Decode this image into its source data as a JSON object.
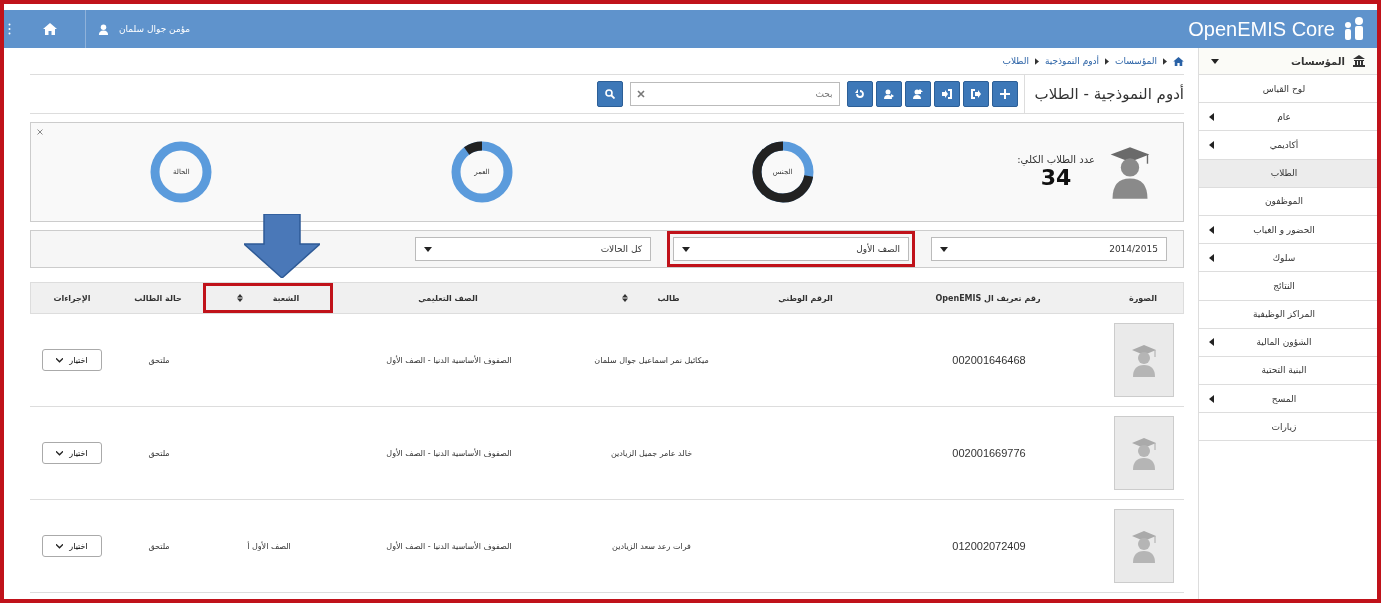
{
  "header": {
    "logo": "OpenEMIS Core",
    "user": "مؤمن جوال سلمان"
  },
  "sidebar": {
    "title": "المؤسسات",
    "items": [
      {
        "label": "لوح القياس",
        "expandable": false,
        "selected": false
      },
      {
        "label": "عام",
        "expandable": true,
        "selected": false
      },
      {
        "label": "أكاديمي",
        "expandable": true,
        "selected": false
      },
      {
        "label": "الطلاب",
        "expandable": false,
        "selected": true
      },
      {
        "label": "الموظفون",
        "expandable": false,
        "selected": false
      },
      {
        "label": "الحضور و الغياب",
        "expandable": true,
        "selected": false
      },
      {
        "label": "سلوك",
        "expandable": true,
        "selected": false
      },
      {
        "label": "النتائج",
        "expandable": false,
        "selected": false
      },
      {
        "label": "المراكز الوظيفية",
        "expandable": false,
        "selected": false
      },
      {
        "label": "الشؤون المالية",
        "expandable": true,
        "selected": false
      },
      {
        "label": "البنية التحتية",
        "expandable": false,
        "selected": false
      },
      {
        "label": "المسح",
        "expandable": true,
        "selected": false
      },
      {
        "label": "زيارات",
        "expandable": false,
        "selected": false
      }
    ]
  },
  "breadcrumb": [
    "المؤسسات",
    "أدوم النموذجية",
    "الطلاب"
  ],
  "page_title": "أدوم النموذجية - الطلاب",
  "search": {
    "placeholder": "بحث"
  },
  "stats": {
    "label": "عدد الطلاب الكلي:",
    "total": "34",
    "charts": [
      {
        "label": "الجنس",
        "kind": "gender"
      },
      {
        "label": "العمر",
        "kind": "age"
      },
      {
        "label": "الحالة",
        "kind": "status"
      }
    ]
  },
  "filters": [
    {
      "value": "2014/2015",
      "highlighted": false
    },
    {
      "value": "الصف الأول",
      "highlighted": true
    },
    {
      "value": "كل الحالات",
      "highlighted": false
    }
  ],
  "table": {
    "columns": [
      {
        "label": "الصورة",
        "sortable": false,
        "highlighted": false
      },
      {
        "label": "رقم تعريف ال OpenEMIS",
        "sortable": false,
        "highlighted": false
      },
      {
        "label": "الرقم الوطني",
        "sortable": false,
        "highlighted": false
      },
      {
        "label": "طالب",
        "sortable": true,
        "highlighted": false
      },
      {
        "label": "الصف التعليمي",
        "sortable": false,
        "highlighted": false
      },
      {
        "label": "الشعبة",
        "sortable": true,
        "highlighted": true
      },
      {
        "label": "حالة الطالب",
        "sortable": false,
        "highlighted": false
      },
      {
        "label": "الإجراءات",
        "sortable": false,
        "highlighted": false
      }
    ],
    "rows": [
      {
        "id": "002001646468",
        "student": "ميكائيل نمر اسماعيل جوال سلمان",
        "grade": "الصفوف الأساسية الدنيا - الصف الأول",
        "class": "",
        "status": "ملتحق",
        "action": "اختيار"
      },
      {
        "id": "002001669776",
        "student": "خالد عامر جميل الزيادين",
        "grade": "الصفوف الأساسية الدنيا - الصف الأول",
        "class": "",
        "status": "ملتحق",
        "action": "اختيار"
      },
      {
        "id": "012002072409",
        "student": "فرات رعد سعد الزيادين",
        "grade": "الصفوف الأساسية الدنيا - الصف الأول",
        "class": "الصف الأول أ",
        "status": "ملتحق",
        "action": "اختيار"
      }
    ]
  }
}
